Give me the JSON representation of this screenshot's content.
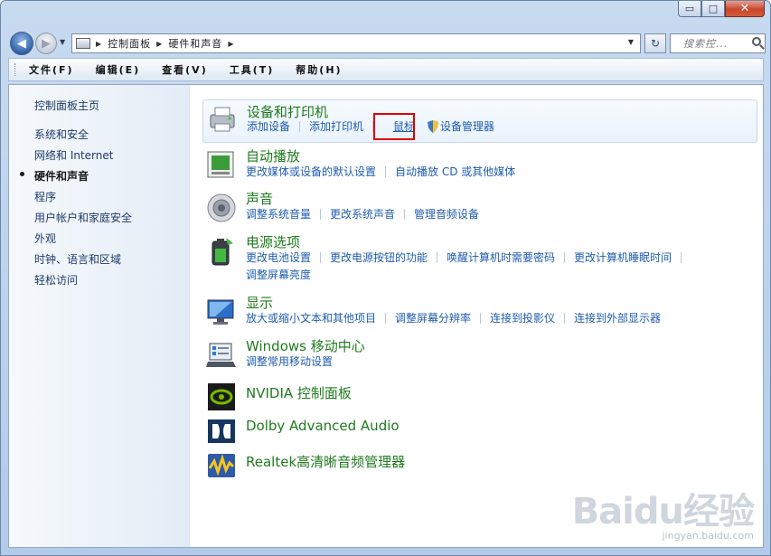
{
  "window": {
    "caption": {
      "minimize": "▭",
      "maximize": "□",
      "close": "✕"
    }
  },
  "nav": {
    "breadcrumb": [
      "控制面板",
      "硬件和声音"
    ],
    "search_placeholder": "搜索控...",
    "refresh": "↻"
  },
  "menu": [
    "文件(F)",
    "编辑(E)",
    "查看(V)",
    "工具(T)",
    "帮助(H)"
  ],
  "sidebar": {
    "home": "控制面板主页",
    "items": [
      "系统和安全",
      "网络和 Internet",
      "硬件和声音",
      "程序",
      "用户帐户和家庭安全",
      "外观",
      "时钟、语言和区域",
      "轻松访问"
    ],
    "current_index": 2
  },
  "categories": {
    "devices": {
      "title": "设备和打印机",
      "links": [
        "添加设备",
        "添加打印机",
        "鼠标",
        "设备管理器"
      ]
    },
    "autoplay": {
      "title": "自动播放",
      "links": [
        "更改媒体或设备的默认设置",
        "自动播放 CD 或其他媒体"
      ]
    },
    "sound": {
      "title": "声音",
      "links": [
        "调整系统音量",
        "更改系统声音",
        "管理音频设备"
      ]
    },
    "power": {
      "title": "电源选项",
      "links": [
        "更改电池设置",
        "更改电源按钮的功能",
        "唤醒计算机时需要密码",
        "更改计算机睡眠时间",
        "调整屏幕亮度"
      ]
    },
    "display": {
      "title": "显示",
      "links": [
        "放大或缩小文本和其他项目",
        "调整屏幕分辨率",
        "连接到投影仪",
        "连接到外部显示器"
      ]
    },
    "mobility": {
      "title": "Windows 移动中心",
      "links": [
        "调整常用移动设置"
      ]
    },
    "nvidia": {
      "title": "NVIDIA 控制面板"
    },
    "dolby": {
      "title": "Dolby Advanced Audio"
    },
    "realtek": {
      "title": "Realtek高清晰音频管理器"
    }
  },
  "watermark": {
    "logo": "Baidu经验",
    "url": "jingyan.baidu.com"
  },
  "colors": {
    "category_title": "#1e7b1e",
    "link": "#1f5cae",
    "highlight": "#e00000"
  }
}
